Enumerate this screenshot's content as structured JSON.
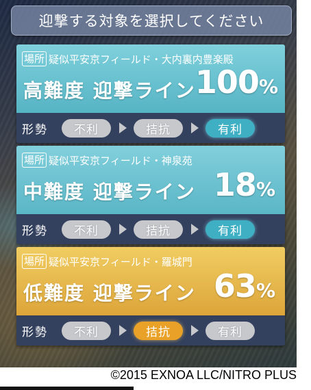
{
  "header": {
    "title": "迎撃する対象を選択してください"
  },
  "cards": [
    {
      "location_tag": "場所",
      "location_name": "疑似平安京フィールド・大内裏内豊楽殿",
      "line_label": "高難度 迎撃ライン",
      "percent": "100",
      "percent_symbol": "%",
      "situation_label": "形勢",
      "situation_options": [
        "不利",
        "拮抗",
        "有利"
      ],
      "situation_selected": "有利",
      "theme_color": "#56b4c4"
    },
    {
      "location_tag": "場所",
      "location_name": "疑似平安京フィールド・神泉苑",
      "line_label": "中難度 迎撃ライン",
      "percent": "18",
      "percent_symbol": "%",
      "situation_label": "形勢",
      "situation_options": [
        "不利",
        "拮抗",
        "有利"
      ],
      "situation_selected": "有利",
      "theme_color": "#5ab6c6"
    },
    {
      "location_tag": "場所",
      "location_name": "疑似平安京フィールド・羅城門",
      "line_label": "低難度 迎撃ライン",
      "percent": "63",
      "percent_symbol": "%",
      "situation_label": "形勢",
      "situation_options": [
        "不利",
        "拮抗",
        "有利"
      ],
      "situation_selected": "拮抗",
      "theme_color": "#dda53a"
    }
  ],
  "footer": {
    "copyright": "©2015 EXNOA LLC/NITRO PLUS"
  }
}
